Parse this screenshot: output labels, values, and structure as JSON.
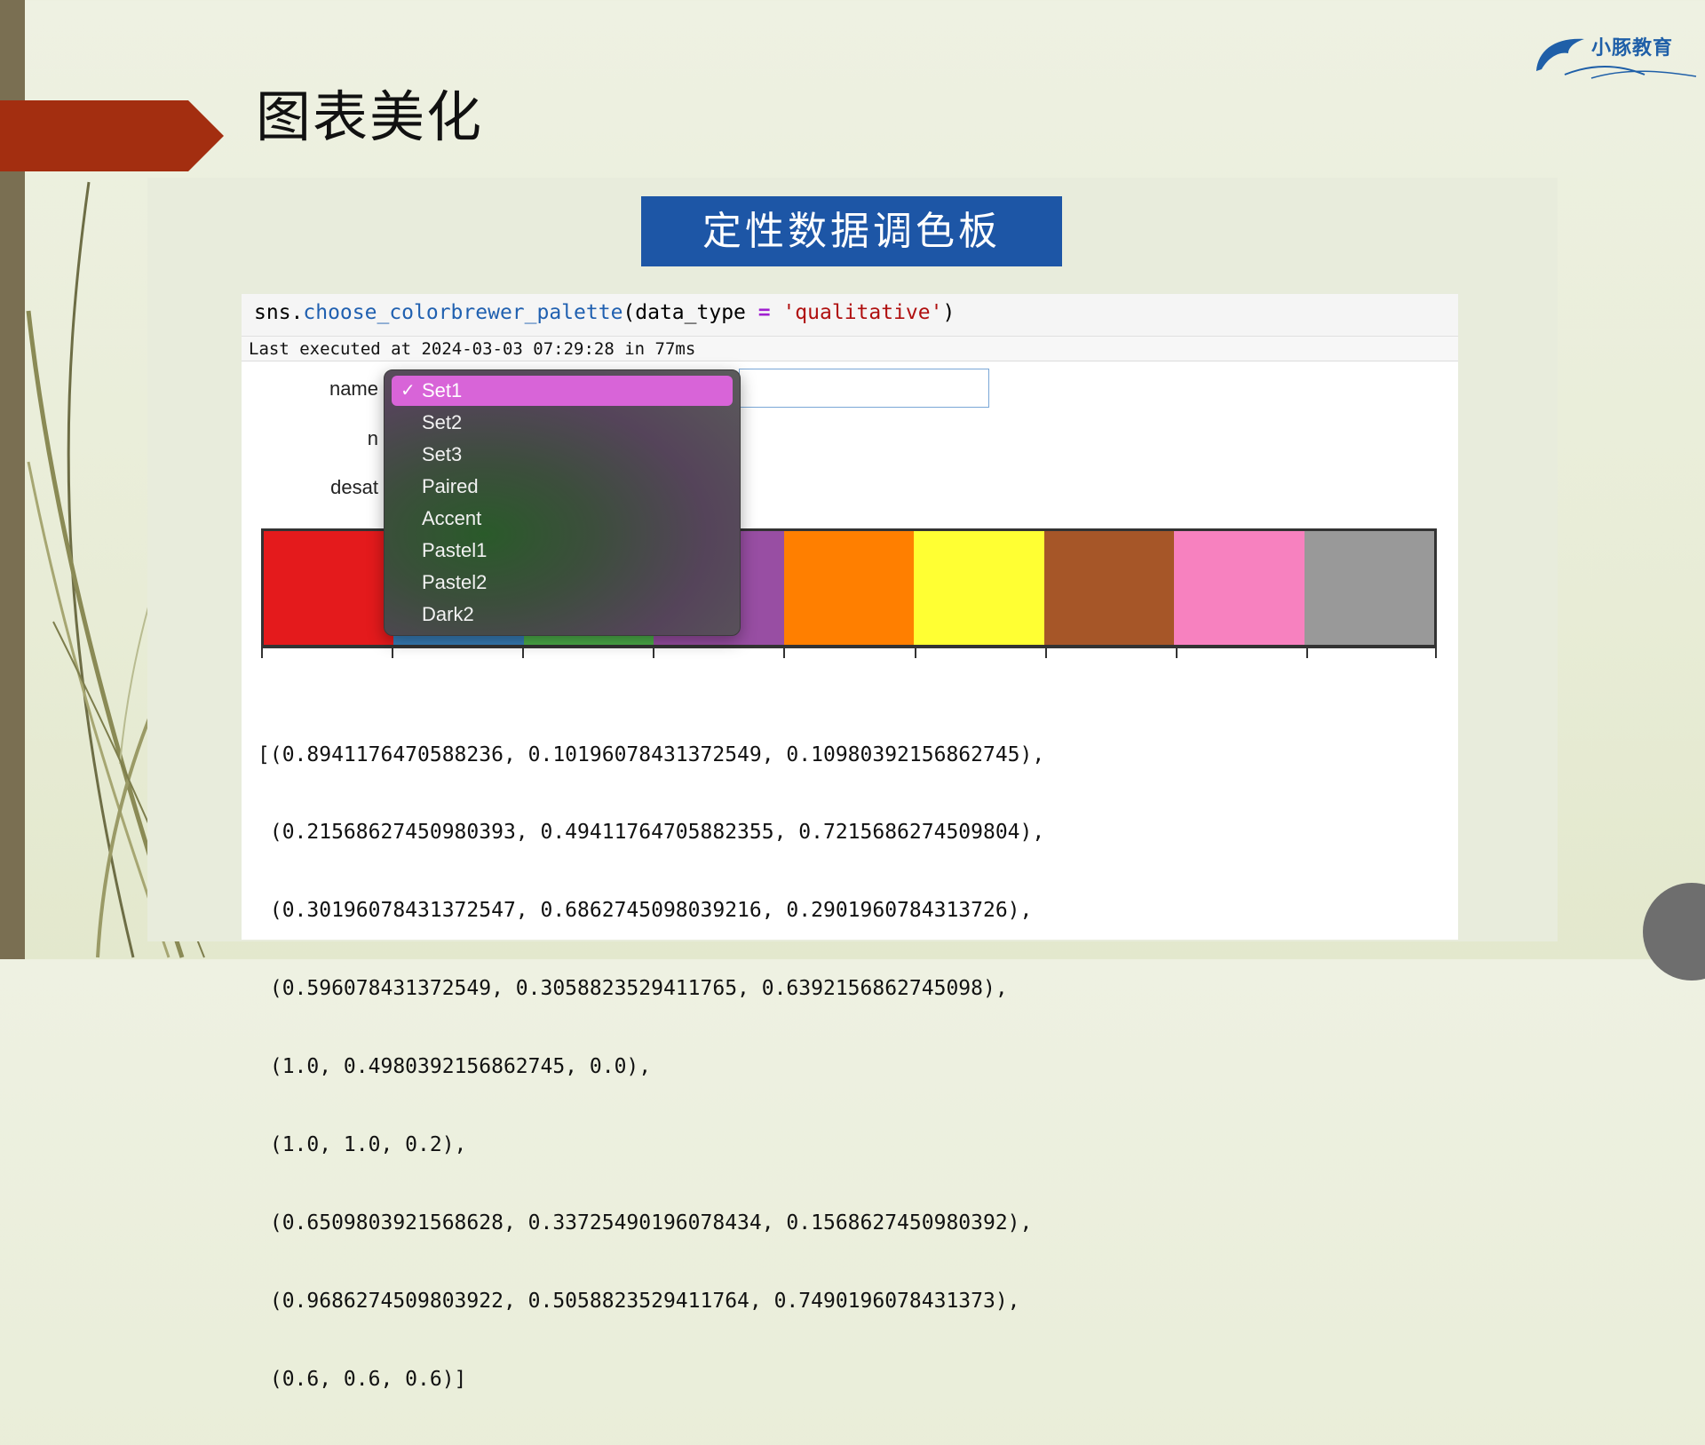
{
  "slide": {
    "title": "图表美化",
    "banner": "定性数据调色板",
    "logo_text": "小豚教育"
  },
  "code_cell": {
    "prefix": "sns.",
    "function": "choose_colorbrewer_palette",
    "arg_open": "(data_type ",
    "operator": "=",
    "string": " 'qualitative'",
    "close": ")"
  },
  "exec_info": "Last executed at 2024-03-03 07:29:28 in 77ms",
  "widgets": {
    "name_label": "name",
    "n_label": "n",
    "desat_label": "desat"
  },
  "dropdown": {
    "selected": "Set1",
    "options": [
      "Set1",
      "Set2",
      "Set3",
      "Paired",
      "Accent",
      "Pastel1",
      "Pastel2",
      "Dark2"
    ]
  },
  "palette_colors": [
    "#e41a1c",
    "#377eb8",
    "#4daf4a",
    "#984ea3",
    "#ff7f00",
    "#ffff33",
    "#a65628",
    "#f781bf",
    "#999999"
  ],
  "output_lines": [
    "[(0.8941176470588236, 0.10196078431372549, 0.10980392156862745),",
    " (0.21568627450980393, 0.49411764705882355, 0.7215686274509804),",
    " (0.30196078431372547, 0.6862745098039216, 0.2901960784313726),",
    " (0.596078431372549, 0.3058823529411765, 0.6392156862745098),",
    " (1.0, 0.4980392156862745, 0.0),",
    " (1.0, 1.0, 0.2),",
    " (0.6509803921568628, 0.33725490196078434, 0.1568627450980392),",
    " (0.9686274509803922, 0.5058823529411764, 0.7490196078431373),",
    " (0.6, 0.6, 0.6)]"
  ]
}
